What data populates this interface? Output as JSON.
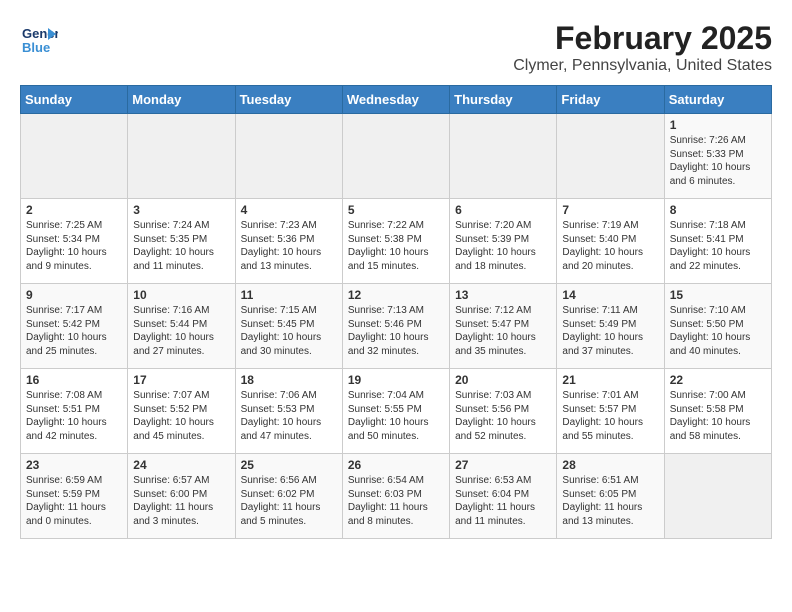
{
  "logo": {
    "line1": "General",
    "line2": "Blue"
  },
  "title": "February 2025",
  "subtitle": "Clymer, Pennsylvania, United States",
  "days_of_week": [
    "Sunday",
    "Monday",
    "Tuesday",
    "Wednesday",
    "Thursday",
    "Friday",
    "Saturday"
  ],
  "weeks": [
    [
      {
        "day": "",
        "info": ""
      },
      {
        "day": "",
        "info": ""
      },
      {
        "day": "",
        "info": ""
      },
      {
        "day": "",
        "info": ""
      },
      {
        "day": "",
        "info": ""
      },
      {
        "day": "",
        "info": ""
      },
      {
        "day": "1",
        "info": "Sunrise: 7:26 AM\nSunset: 5:33 PM\nDaylight: 10 hours and 6 minutes."
      }
    ],
    [
      {
        "day": "2",
        "info": "Sunrise: 7:25 AM\nSunset: 5:34 PM\nDaylight: 10 hours and 9 minutes."
      },
      {
        "day": "3",
        "info": "Sunrise: 7:24 AM\nSunset: 5:35 PM\nDaylight: 10 hours and 11 minutes."
      },
      {
        "day": "4",
        "info": "Sunrise: 7:23 AM\nSunset: 5:36 PM\nDaylight: 10 hours and 13 minutes."
      },
      {
        "day": "5",
        "info": "Sunrise: 7:22 AM\nSunset: 5:38 PM\nDaylight: 10 hours and 15 minutes."
      },
      {
        "day": "6",
        "info": "Sunrise: 7:20 AM\nSunset: 5:39 PM\nDaylight: 10 hours and 18 minutes."
      },
      {
        "day": "7",
        "info": "Sunrise: 7:19 AM\nSunset: 5:40 PM\nDaylight: 10 hours and 20 minutes."
      },
      {
        "day": "8",
        "info": "Sunrise: 7:18 AM\nSunset: 5:41 PM\nDaylight: 10 hours and 22 minutes."
      }
    ],
    [
      {
        "day": "9",
        "info": "Sunrise: 7:17 AM\nSunset: 5:42 PM\nDaylight: 10 hours and 25 minutes."
      },
      {
        "day": "10",
        "info": "Sunrise: 7:16 AM\nSunset: 5:44 PM\nDaylight: 10 hours and 27 minutes."
      },
      {
        "day": "11",
        "info": "Sunrise: 7:15 AM\nSunset: 5:45 PM\nDaylight: 10 hours and 30 minutes."
      },
      {
        "day": "12",
        "info": "Sunrise: 7:13 AM\nSunset: 5:46 PM\nDaylight: 10 hours and 32 minutes."
      },
      {
        "day": "13",
        "info": "Sunrise: 7:12 AM\nSunset: 5:47 PM\nDaylight: 10 hours and 35 minutes."
      },
      {
        "day": "14",
        "info": "Sunrise: 7:11 AM\nSunset: 5:49 PM\nDaylight: 10 hours and 37 minutes."
      },
      {
        "day": "15",
        "info": "Sunrise: 7:10 AM\nSunset: 5:50 PM\nDaylight: 10 hours and 40 minutes."
      }
    ],
    [
      {
        "day": "16",
        "info": "Sunrise: 7:08 AM\nSunset: 5:51 PM\nDaylight: 10 hours and 42 minutes."
      },
      {
        "day": "17",
        "info": "Sunrise: 7:07 AM\nSunset: 5:52 PM\nDaylight: 10 hours and 45 minutes."
      },
      {
        "day": "18",
        "info": "Sunrise: 7:06 AM\nSunset: 5:53 PM\nDaylight: 10 hours and 47 minutes."
      },
      {
        "day": "19",
        "info": "Sunrise: 7:04 AM\nSunset: 5:55 PM\nDaylight: 10 hours and 50 minutes."
      },
      {
        "day": "20",
        "info": "Sunrise: 7:03 AM\nSunset: 5:56 PM\nDaylight: 10 hours and 52 minutes."
      },
      {
        "day": "21",
        "info": "Sunrise: 7:01 AM\nSunset: 5:57 PM\nDaylight: 10 hours and 55 minutes."
      },
      {
        "day": "22",
        "info": "Sunrise: 7:00 AM\nSunset: 5:58 PM\nDaylight: 10 hours and 58 minutes."
      }
    ],
    [
      {
        "day": "23",
        "info": "Sunrise: 6:59 AM\nSunset: 5:59 PM\nDaylight: 11 hours and 0 minutes."
      },
      {
        "day": "24",
        "info": "Sunrise: 6:57 AM\nSunset: 6:00 PM\nDaylight: 11 hours and 3 minutes."
      },
      {
        "day": "25",
        "info": "Sunrise: 6:56 AM\nSunset: 6:02 PM\nDaylight: 11 hours and 5 minutes."
      },
      {
        "day": "26",
        "info": "Sunrise: 6:54 AM\nSunset: 6:03 PM\nDaylight: 11 hours and 8 minutes."
      },
      {
        "day": "27",
        "info": "Sunrise: 6:53 AM\nSunset: 6:04 PM\nDaylight: 11 hours and 11 minutes."
      },
      {
        "day": "28",
        "info": "Sunrise: 6:51 AM\nSunset: 6:05 PM\nDaylight: 11 hours and 13 minutes."
      },
      {
        "day": "",
        "info": ""
      }
    ]
  ]
}
